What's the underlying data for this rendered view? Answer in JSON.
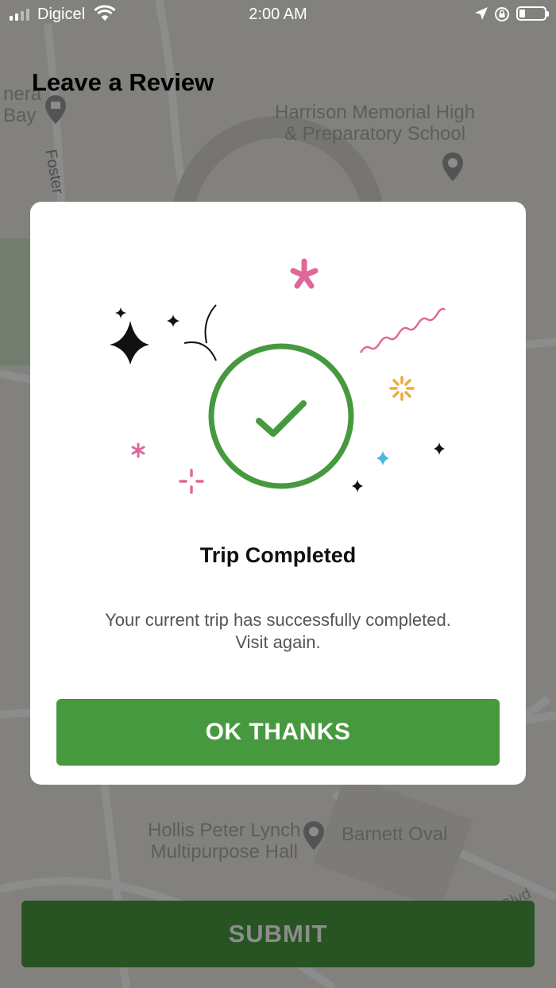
{
  "status_bar": {
    "carrier": "Digicel",
    "time": "2:00 AM"
  },
  "header": {
    "title": "Leave a Review"
  },
  "map": {
    "labels": {
      "school": "Harrison Memorial High\n& Preparatory School",
      "hall": "Hollis Peter Lynch\nMultipurpose Hall",
      "oval": "Barnett Oval",
      "hills_blvd": "Hills Blvd",
      "foster": "Foster",
      "bay": "nera\nBay"
    }
  },
  "dialog": {
    "title": "Trip Completed",
    "message": "Your current trip has successfully completed.\nVisit again.",
    "ok_label": "OK THANKS",
    "icon": "check-circle-icon"
  },
  "footer": {
    "submit_label": "SUBMIT"
  },
  "colors": {
    "accent_green": "#47993f",
    "pink": "#e0679a",
    "orange": "#f2a93b",
    "blue": "#4cb8e0"
  }
}
